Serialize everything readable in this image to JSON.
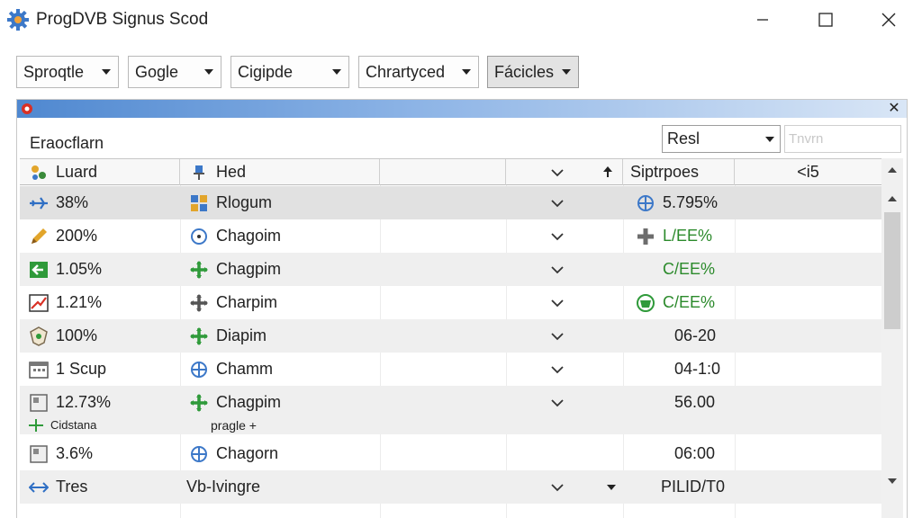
{
  "window": {
    "title": "ProgDVB Signus Scod",
    "icon": "gear-icon",
    "controls": [
      "minimize-icon",
      "maximize-icon",
      "close-icon"
    ]
  },
  "toolbar": {
    "dropdowns": [
      {
        "label": "Sproqtle"
      },
      {
        "label": "Gogle"
      },
      {
        "label": "Cigipde"
      },
      {
        "label": "Chrartyced"
      },
      {
        "label": "Fácicles"
      }
    ]
  },
  "panel": {
    "filter_label": "Eraocflarn",
    "select_value": "Resl",
    "search_placeholder": "Tnvrn",
    "columns": [
      "Luard",
      "Hed",
      "",
      "",
      "Siptrpoes",
      "<i5"
    ],
    "rows": [
      {
        "c1": "38%",
        "c1_icon": "plane-icon",
        "c2": "Rlogum",
        "c2_icon": "grid-icon",
        "c4": "5.795%",
        "c4_icon": "globe-icon",
        "c4_green": false
      },
      {
        "c1": "200%",
        "c1_icon": "pencil-icon",
        "c2": "Chagoim",
        "c2_icon": "clock-icon",
        "c4": "L/EE%",
        "c4_icon": "plus-icon",
        "c4_green": true
      },
      {
        "c1": "1.05%",
        "c1_icon": "green-arrow-icon",
        "c2": "Chagpim",
        "c2_icon": "move-icon",
        "c4": "C/EE%",
        "c4_icon": "",
        "c4_green": true
      },
      {
        "c1": "1.21%",
        "c1_icon": "chart-icon",
        "c2": "Charpim",
        "c2_icon": "move-icon",
        "c4": "C/EE%",
        "c4_icon": "basket-icon",
        "c4_green": true
      },
      {
        "c1": "100%",
        "c1_icon": "shield-icon",
        "c2": "Diapim",
        "c2_icon": "move-icon",
        "c4": "06-20",
        "c4_icon": "",
        "c4_green": false
      },
      {
        "c1": "1 Scup",
        "c1_icon": "calendar-icon",
        "c2": "Chamm",
        "c2_icon": "crosshair-icon",
        "c4": "04-1:0",
        "c4_icon": "",
        "c4_green": false
      },
      {
        "c1": "12.73%",
        "c1_icon": "document-icon",
        "c2": "Chagpim",
        "c2_icon": "move-icon",
        "c4": "56.00",
        "c4_icon": "",
        "c4_green": false,
        "sub1": "Cidstana",
        "sub2": "pragle +"
      },
      {
        "c1": "3.6%",
        "c1_icon": "document-icon",
        "c2": "Chagorn",
        "c2_icon": "crosshair-icon",
        "c4": "06:00",
        "c4_icon": "",
        "c4_green": false
      },
      {
        "c1": "Tres",
        "c1_icon": "double-arrow-icon",
        "c2": "Vb-Ivingre",
        "c2_icon": "",
        "c4": "PILID/T0",
        "c4_icon": "",
        "c4_green": false
      }
    ]
  },
  "colors": {
    "accent_gradient_start": "#4f88d0",
    "accent_gradient_end": "#d9e6f6",
    "positive": "#2b8a2b",
    "selected_row": "#e1e1e1",
    "alt_row": "#efefef"
  }
}
